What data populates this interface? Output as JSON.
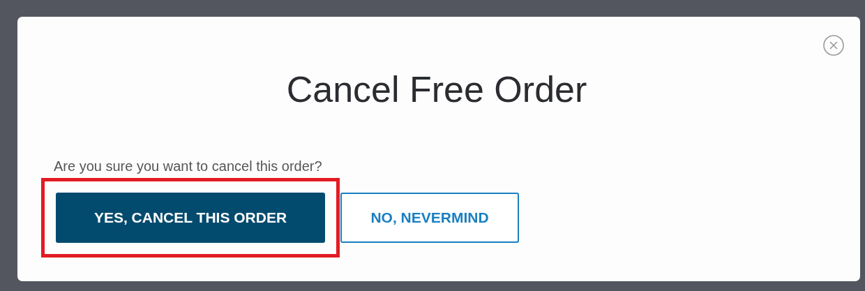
{
  "dialog": {
    "title": "Cancel Free Order",
    "message": "Are you sure you want to cancel this order?",
    "buttons": [
      {
        "label": "YES, CANCEL THIS ORDER",
        "kind": "primary",
        "highlighted": true
      },
      {
        "label": "NO, NEVERMIND",
        "kind": "secondary",
        "highlighted": false
      }
    ]
  }
}
